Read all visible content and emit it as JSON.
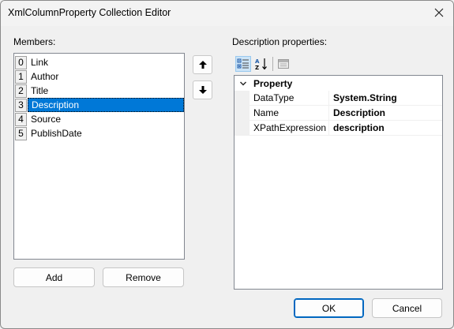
{
  "window": {
    "title": "XmlColumnProperty Collection Editor"
  },
  "members": {
    "label": "Members:",
    "items": [
      {
        "index": "0",
        "label": "Link"
      },
      {
        "index": "1",
        "label": "Author"
      },
      {
        "index": "2",
        "label": "Title"
      },
      {
        "index": "3",
        "label": "Description",
        "selected": true
      },
      {
        "index": "4",
        "label": "Source"
      },
      {
        "index": "5",
        "label": "PublishDate"
      }
    ]
  },
  "buttons": {
    "add": "Add",
    "remove": "Remove",
    "ok": "OK",
    "cancel": "Cancel"
  },
  "properties": {
    "label": "Description properties:",
    "category": "Property",
    "rows": [
      {
        "name": "DataType",
        "value": "System.String"
      },
      {
        "name": "Name",
        "value": "Description"
      },
      {
        "name": "XPathExpression",
        "value": "description"
      }
    ]
  },
  "colors": {
    "selection": "#0078d7",
    "accent": "#0067c0"
  }
}
